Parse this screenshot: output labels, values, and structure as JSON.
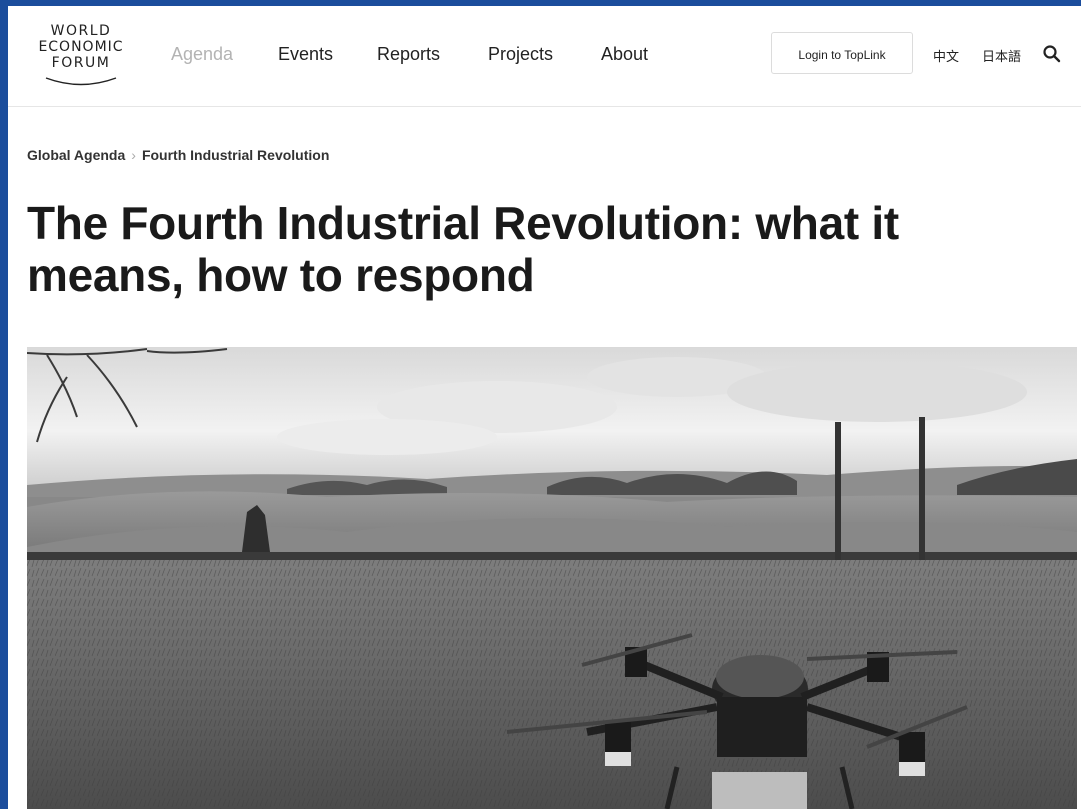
{
  "header": {
    "logo": {
      "line1": "WORLD",
      "line2": "ECONOMIC",
      "line3": "FORUM"
    },
    "nav": [
      {
        "label": "Agenda",
        "active": true
      },
      {
        "label": "Events"
      },
      {
        "label": "Reports"
      },
      {
        "label": "Projects"
      },
      {
        "label": "About"
      }
    ],
    "login_label": "Login to TopLink",
    "lang_chinese": "中文",
    "lang_japanese": "日本語",
    "search_icon": "search-icon"
  },
  "breadcrumb": {
    "items": [
      "Global Agenda",
      "Fourth Industrial Revolution"
    ]
  },
  "article": {
    "title": "The Fourth Industrial Revolution: what it means, how to respond",
    "hero_image": "drone-on-grass-field-photo"
  },
  "colors": {
    "page_frame": "#1b4d9c",
    "nav_muted": "#b3b3b3",
    "text": "#1a1a1a"
  }
}
